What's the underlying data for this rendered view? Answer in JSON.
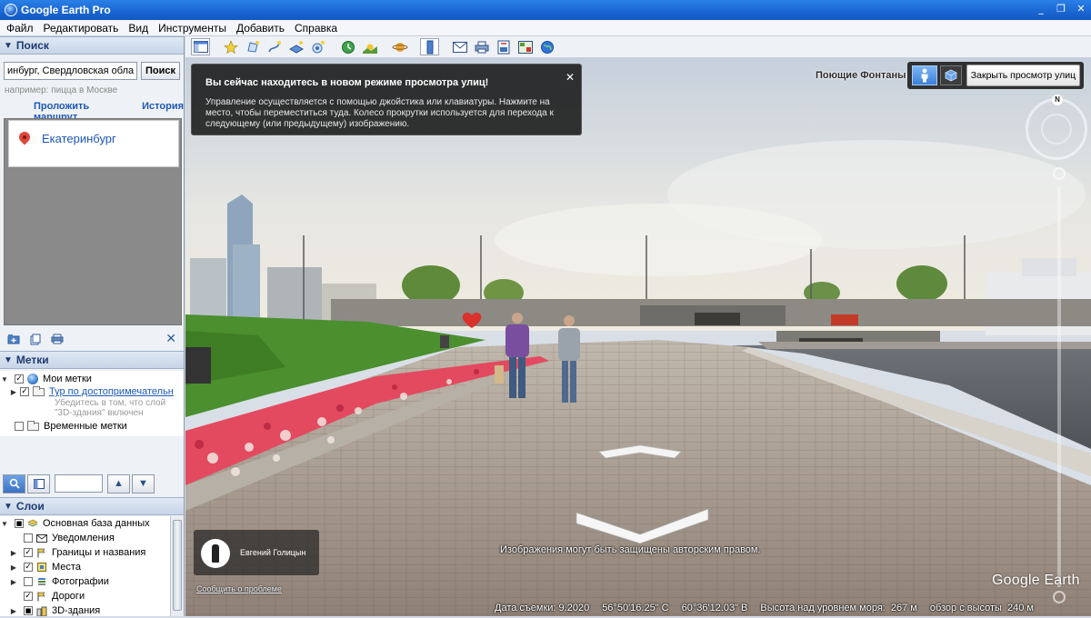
{
  "window": {
    "title": "Google Earth Pro",
    "controls": [
      "_",
      "❐",
      "✕"
    ]
  },
  "menu": [
    "Файл",
    "Редактировать",
    "Вид",
    "Инструменты",
    "Добавить",
    "Справка"
  ],
  "search": {
    "header": "Поиск",
    "input_value": "инбург, Свердловская область",
    "button_label": "Поиск",
    "hint": "например: пицца в Москве",
    "route_link": "Проложить маршрут",
    "history_link": "История",
    "result": "Екатеринбург"
  },
  "places": {
    "header": "Метки",
    "items": [
      {
        "label": "Мои метки",
        "checked": true
      },
      {
        "label": "Тур по достопримечательн",
        "checked": true,
        "note": "Убедитесь в том, что слой \"3D-здания\" включен"
      },
      {
        "label": "Временные метки",
        "checked": false
      }
    ]
  },
  "layers": {
    "header": "Слои",
    "items": [
      {
        "label": "Основная база данных",
        "checked": "partial"
      },
      {
        "label": "Уведомления",
        "checked": false
      },
      {
        "label": "Границы и названия",
        "checked": true
      },
      {
        "label": "Места",
        "checked": true
      },
      {
        "label": "Фотографии",
        "checked": false
      },
      {
        "label": "Дороги",
        "checked": true
      },
      {
        "label": "3D-здания",
        "checked": "partial"
      }
    ]
  },
  "street_view": {
    "info_title": "Вы сейчас находитесь в новом режиме просмотра улиц!",
    "info_text": "Управление осуществляется с помощью джойстика или клавиатуры. Нажмите на место, чтобы переместиться туда. Колесо прокрутки используется для перехода к следующему (или предыдущему) изображению.",
    "info_close": "✕",
    "place_label": "Поющие Фонтаны",
    "exit_button": "Закрыть просмотр улиц",
    "compass_n": "N",
    "author": "Евгений Голицын",
    "report_link": "Сообщить о проблеме",
    "copyright": "Изображения могут быть защищены авторским правом.",
    "logo": "Google Earth"
  },
  "status": {
    "date": "Дата съемки: 9.2020",
    "lat": "56°50'16.25\" С",
    "lon": "60°36'12.03\" В",
    "elevation_label": "Высота над уровнем моря:",
    "elevation_value": "267 м",
    "eye_label": "обзор с высоты",
    "eye_value": "240 м"
  },
  "colors": {
    "titlebar": "#1a66d2",
    "panel_header": "#c7d5e8",
    "link": "#1d58b8",
    "sky": "#bfcbd9",
    "flowers": "#e34a5f",
    "grass": "#4b8f2e",
    "pavement": "#a3958a"
  }
}
